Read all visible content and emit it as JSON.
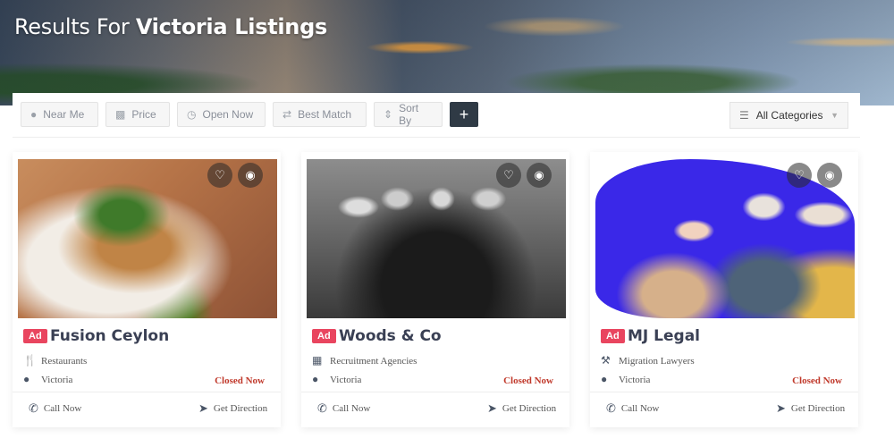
{
  "hero": {
    "title_prefix": "Results For ",
    "title_bold": "Victoria Listings"
  },
  "filters": {
    "near_me": "Near Me",
    "price": "Price",
    "open_now": "Open Now",
    "best_match": "Best Match",
    "sort_by": "Sort By",
    "more": "+",
    "categories": "All Categories"
  },
  "listings": [
    {
      "badge": "Ad",
      "name": "Fusion Ceylon",
      "category": "Restaurants",
      "category_icon": "utensils-icon",
      "location": "Victoria",
      "status": "Closed Now",
      "call": "Call Now",
      "direction": "Get Direction"
    },
    {
      "badge": "Ad",
      "name": "Woods & Co",
      "category": "Recruitment Agencies",
      "category_icon": "building-icon",
      "location": "Victoria",
      "status": "Closed Now",
      "call": "Call Now",
      "direction": "Get Direction"
    },
    {
      "badge": "Ad",
      "name": "MJ Legal",
      "category": "Migration Lawyers",
      "category_icon": "gavel-icon",
      "location": "Victoria",
      "status": "Closed Now",
      "call": "Call Now",
      "direction": "Get Direction"
    }
  ],
  "colors": {
    "ad_badge": "#e9455f",
    "closed": "#c0392b",
    "accent_dark": "#2f3a45"
  }
}
